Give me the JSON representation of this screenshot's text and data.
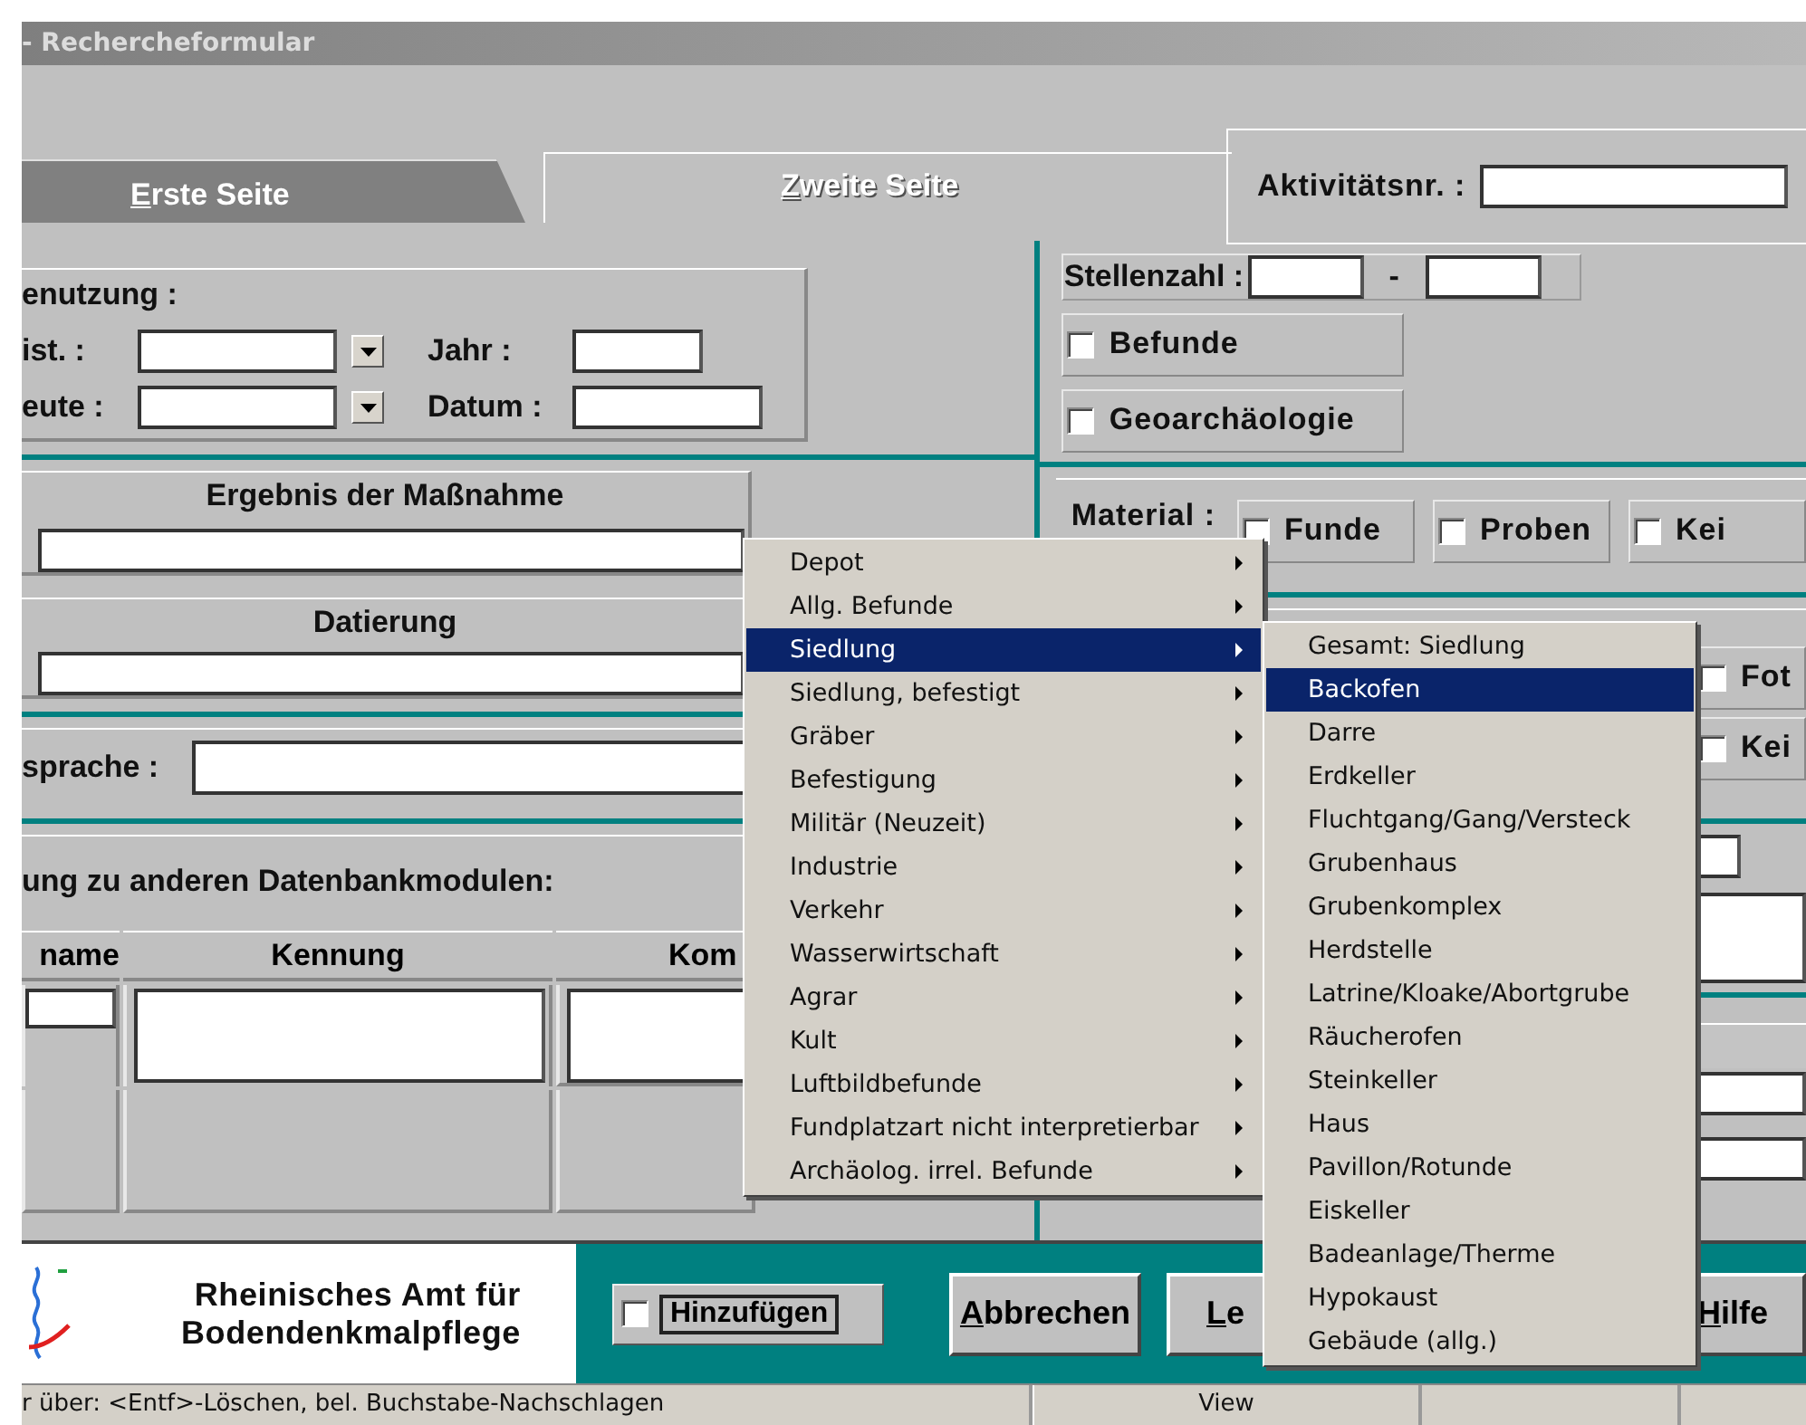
{
  "window": {
    "title": "- Rechercheformular"
  },
  "tabs": [
    {
      "label": "Erste Seite",
      "selected": false,
      "accelerator": true
    },
    {
      "label": "Zweite Seite",
      "selected": true,
      "accelerator": true
    }
  ],
  "activity": {
    "label": "Aktivitätsnr. :"
  },
  "usage": {
    "title": "enutzung :",
    "rows": [
      {
        "label": "ist. :",
        "side_label": "Jahr :"
      },
      {
        "label": "eute :",
        "side_label": "Datum :"
      }
    ]
  },
  "result": {
    "title": "Ergebnis der Maßnahme"
  },
  "dating": {
    "title": "Datierung"
  },
  "language": {
    "label": "sprache :"
  },
  "links": {
    "title": "ung zu anderen Datenbankmodulen:",
    "columns": [
      "name",
      "Kennung",
      "Kom"
    ]
  },
  "count": {
    "label": "Stellenzahl :",
    "separator": "-"
  },
  "features": [
    {
      "label": "Befunde",
      "checked": false
    },
    {
      "label": "Geoarchäologie",
      "checked": false
    }
  ],
  "material": {
    "label": "Material :",
    "options": [
      {
        "label": "Funde",
        "checked": false
      },
      {
        "label": "Proben",
        "checked": false
      },
      {
        "label": "Kei",
        "checked": false
      }
    ]
  },
  "documents": [
    {
      "label": "Fot",
      "checked": false
    },
    {
      "label": "Kei",
      "checked": false
    }
  ],
  "footer": {
    "org_lines": [
      "Rheinisches Amt für",
      "Bodendenkmalpflege"
    ],
    "add": {
      "label": "Hinzufügen",
      "checked": false
    },
    "buttons": [
      {
        "label": "Abbrechen",
        "accelerator": true
      },
      {
        "label": "Le",
        "accelerator": true
      },
      {
        "label": "Hilfe",
        "accelerator": true
      }
    ]
  },
  "status_bar": [
    "r über: <Entf>-Löschen, bel. Buchstabe-Nachschlagen",
    "View"
  ],
  "menu": {
    "items": [
      {
        "label": "Depot",
        "has_submenu": true,
        "selected": false
      },
      {
        "label": "Allg. Befunde",
        "has_submenu": true,
        "selected": false
      },
      {
        "label": "Siedlung",
        "has_submenu": true,
        "selected": true
      },
      {
        "label": "Siedlung, befestigt",
        "has_submenu": true,
        "selected": false
      },
      {
        "label": "Gräber",
        "has_submenu": true,
        "selected": false
      },
      {
        "label": "Befestigung",
        "has_submenu": true,
        "selected": false
      },
      {
        "label": "Militär (Neuzeit)",
        "has_submenu": true,
        "selected": false
      },
      {
        "label": "Industrie",
        "has_submenu": true,
        "selected": false
      },
      {
        "label": "Verkehr",
        "has_submenu": true,
        "selected": false
      },
      {
        "label": "Wasserwirtschaft",
        "has_submenu": true,
        "selected": false
      },
      {
        "label": "Agrar",
        "has_submenu": true,
        "selected": false
      },
      {
        "label": "Kult",
        "has_submenu": true,
        "selected": false
      },
      {
        "label": "Luftbildbefunde",
        "has_submenu": true,
        "selected": false
      },
      {
        "label": "Fundplatzart nicht interpretierbar",
        "has_submenu": true,
        "selected": false
      },
      {
        "label": "Archäolog. irrel. Befunde",
        "has_submenu": true,
        "selected": false
      }
    ]
  },
  "submenu": {
    "items": [
      {
        "label": "Gesamt: Siedlung",
        "selected": false
      },
      {
        "label": "Backofen",
        "selected": true
      },
      {
        "label": "Darre",
        "selected": false
      },
      {
        "label": "Erdkeller",
        "selected": false
      },
      {
        "label": "Fluchtgang/Gang/Versteck",
        "selected": false
      },
      {
        "label": "Grubenhaus",
        "selected": false
      },
      {
        "label": "Grubenkomplex",
        "selected": false
      },
      {
        "label": "Herdstelle",
        "selected": false
      },
      {
        "label": "Latrine/Kloake/Abortgrube",
        "selected": false
      },
      {
        "label": "Räucherofen",
        "selected": false
      },
      {
        "label": "Steinkeller",
        "selected": false
      },
      {
        "label": "Haus",
        "selected": false
      },
      {
        "label": "Pavillon/Rotunde",
        "selected": false
      },
      {
        "label": "Eiskeller",
        "selected": false
      },
      {
        "label": "Badeanlage/Therme",
        "selected": false
      },
      {
        "label": "Hypokaust",
        "selected": false
      },
      {
        "label": "Gebäude (allg.)",
        "selected": false
      }
    ]
  }
}
